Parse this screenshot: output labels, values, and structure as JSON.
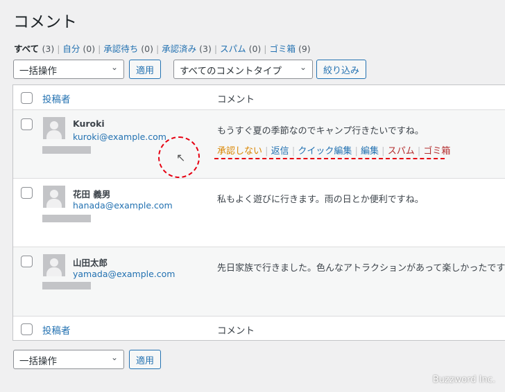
{
  "page": {
    "title": "コメント",
    "credit": "Buzzword Inc."
  },
  "filters": [
    {
      "label": "すべて",
      "count": "(3)"
    },
    {
      "label": "自分",
      "count": "(0)"
    },
    {
      "label": "承認待ち",
      "count": "(0)"
    },
    {
      "label": "承認済み",
      "count": "(3)"
    },
    {
      "label": "スパム",
      "count": "(0)"
    },
    {
      "label": "ゴミ箱",
      "count": "(9)"
    }
  ],
  "toolbar": {
    "bulk": "一括操作",
    "apply": "適用",
    "type": "すべてのコメントタイプ",
    "filter": "絞り込み"
  },
  "table": {
    "col_author": "投稿者",
    "col_comment": "コメント"
  },
  "comments": [
    {
      "name": "Kuroki",
      "email": "kuroki@example.com",
      "text": "もうすぐ夏の季節なのでキャンプ行きたいですね。"
    },
    {
      "name": "花田 義男",
      "email": "hanada@example.com",
      "text": "私もよく遊びに行きます。雨の日とか便利ですね。"
    },
    {
      "name": "山田太郎",
      "email": "yamada@example.com",
      "text": "先日家族で行きました。色んなアトラクションがあって楽しかったです"
    }
  ],
  "row_actions": {
    "unapprove": "承認しない",
    "reply": "返信",
    "quick_edit": "クイック編集",
    "edit": "編集",
    "spam": "スパム",
    "trash": "ゴミ箱"
  },
  "colors": {
    "link": "#2271b1",
    "unapprove": "#d98500",
    "danger": "#b32d2e",
    "annotation": "#e60012"
  }
}
